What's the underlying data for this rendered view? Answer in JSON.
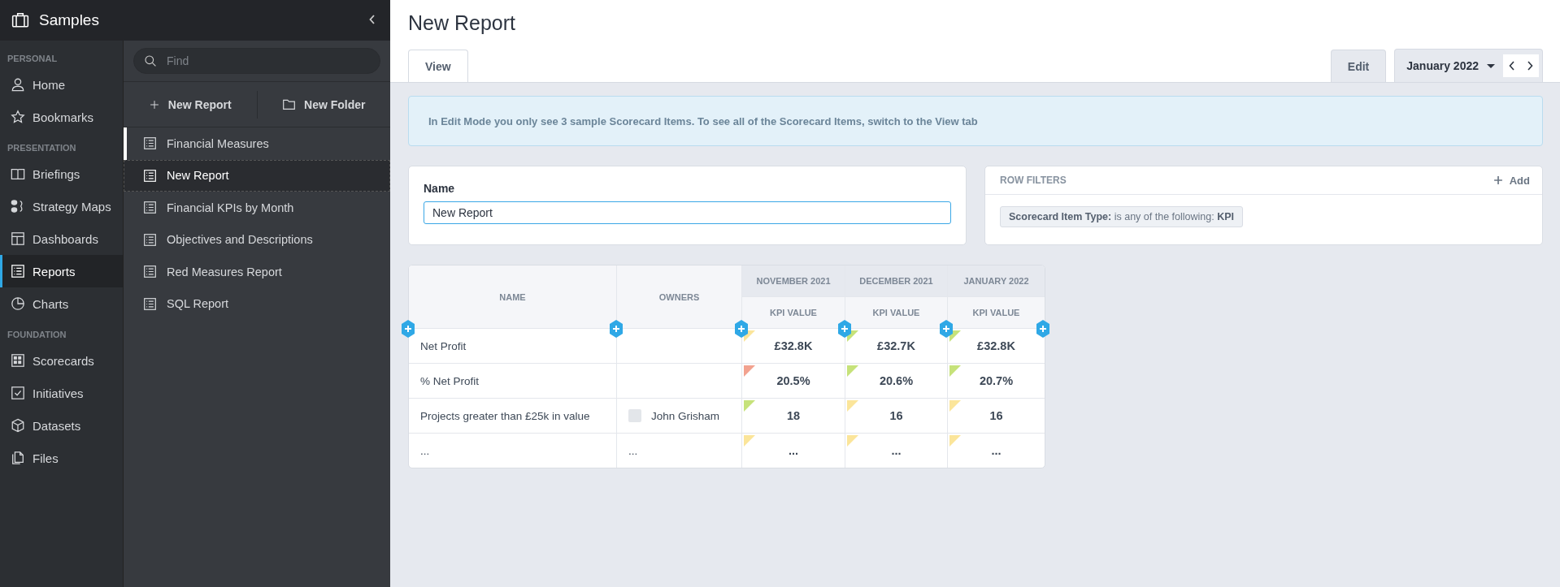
{
  "app_header": {
    "title": "Samples"
  },
  "nav": {
    "sections": [
      {
        "label": "PERSONAL",
        "items": [
          {
            "label": "Home",
            "selected": false
          },
          {
            "label": "Bookmarks",
            "selected": false
          }
        ]
      },
      {
        "label": "PRESENTATION",
        "items": [
          {
            "label": "Briefings",
            "selected": false
          },
          {
            "label": "Strategy Maps",
            "selected": false
          },
          {
            "label": "Dashboards",
            "selected": false
          },
          {
            "label": "Reports",
            "selected": true
          },
          {
            "label": "Charts",
            "selected": false
          }
        ]
      },
      {
        "label": "FOUNDATION",
        "items": [
          {
            "label": "Scorecards",
            "selected": false
          },
          {
            "label": "Initiatives",
            "selected": false
          },
          {
            "label": "Datasets",
            "selected": false
          },
          {
            "label": "Files",
            "selected": false
          }
        ]
      }
    ]
  },
  "reports_panel": {
    "search": {
      "placeholder": "Find"
    },
    "actions": [
      "New Report",
      "New Folder"
    ],
    "items": [
      {
        "label": "Financial Measures",
        "selected": false,
        "highlighted": true
      },
      {
        "label": "New Report",
        "selected": true,
        "highlighted": false
      },
      {
        "label": "Financial KPIs by Month",
        "selected": false,
        "highlighted": false
      },
      {
        "label": "Objectives and Descriptions",
        "selected": false,
        "highlighted": false
      },
      {
        "label": "Red Measures Report",
        "selected": false,
        "highlighted": false
      },
      {
        "label": "SQL Report",
        "selected": false,
        "highlighted": false
      }
    ]
  },
  "page": {
    "title": "New Report",
    "tabs": [
      {
        "label": "View",
        "selected": false
      },
      {
        "label": "Edit",
        "selected": true
      }
    ],
    "period": "January 2022"
  },
  "banner": "In Edit Mode you only see 3 sample Scorecard Items. To see all of the Scorecard Items, switch to the View tab",
  "name_card": {
    "label": "Name",
    "value": "New Report"
  },
  "row_filters": {
    "title": "ROW FILTERS",
    "add": "Add",
    "filter": "**Scorecard Item Type:** is any of the following: **KPI**"
  },
  "table": {
    "columns": [
      "NAME",
      "OWNERS"
    ],
    "periods": [
      "NOVEMBER 2021",
      "DECEMBER 2021",
      "JANUARY 2022"
    ],
    "sub_labels": [
      "KPI VALUE",
      "KPI VALUE",
      "KPI VALUE"
    ],
    "rows": [
      {
        "name": "Net Profit",
        "owner": "",
        "cells": [
          {
            "value": "£32.8K",
            "color": "#fbe59a"
          },
          {
            "value": "£32.7K",
            "color": "#c6e27a"
          },
          {
            "value": "£32.8K",
            "color": "#c6e27a"
          }
        ]
      },
      {
        "name": "% Net Profit",
        "owner": "",
        "cells": [
          {
            "value": "20.5%",
            "color": "#f2a28f"
          },
          {
            "value": "20.6%",
            "color": "#c6e27a"
          },
          {
            "value": "20.7%",
            "color": "#c6e27a"
          }
        ]
      },
      {
        "name": "Projects greater than £25k in value",
        "owner": "John Grisham",
        "cells": [
          {
            "value": "18",
            "color": "#c6e27a"
          },
          {
            "value": "16",
            "color": "#fbe59a"
          },
          {
            "value": "16",
            "color": "#fbe59a"
          }
        ]
      },
      {
        "name": "...",
        "owner": "...",
        "cells": [
          {
            "value": "...",
            "color": "#fbe59a"
          },
          {
            "value": "...",
            "color": "#fbe59a"
          },
          {
            "value": "...",
            "color": "#fbe59a"
          }
        ]
      }
    ]
  }
}
